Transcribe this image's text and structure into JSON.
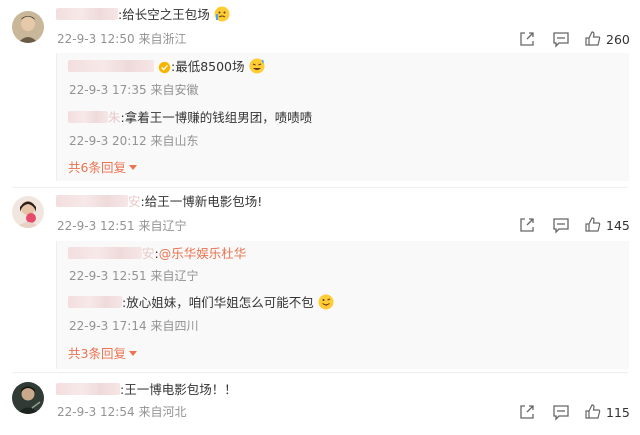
{
  "comments": [
    {
      "text": ":给长空之王包场",
      "time": "22-9-3 12:50",
      "location": "来自浙江",
      "likes": "260",
      "replies": [
        {
          "text": ":最低8500场",
          "time": "22-9-3 17:35",
          "location": "来自安徽"
        },
        {
          "text": ":拿着王一博赚的钱组男团，啧啧啧",
          "time": "22-9-3 20:12",
          "location": "来自山东"
        }
      ],
      "more": "共6条回复"
    },
    {
      "text": ":给王一博新电影包场!",
      "time": "22-9-3 12:51",
      "location": "来自辽宁",
      "likes": "145",
      "replies": [
        {
          "text_prefix": ":",
          "mention": "@乐华娱乐杜华",
          "time": "22-9-3 12:51",
          "location": "来自辽宁"
        },
        {
          "text": ":放心姐妹，咱们华姐怎么可能不包",
          "time": "22-9-3 17:14",
          "location": "来自四川"
        }
      ],
      "more": "共3条回复"
    },
    {
      "text": ":王一博电影包场！！",
      "time": "22-9-3 12:54",
      "location": "来自河北",
      "likes": "115"
    }
  ],
  "partial_suffix": {
    "c1": "安",
    "r4": "安",
    "r2": "朱"
  },
  "colors": {
    "accent": "#eb7350",
    "meta": "#939393",
    "text": "#333333"
  }
}
